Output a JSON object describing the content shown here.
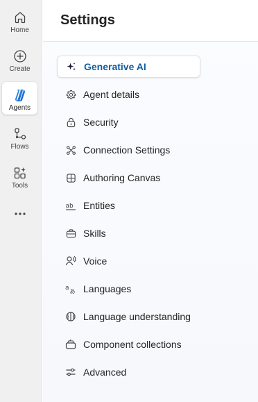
{
  "rail": {
    "items": [
      {
        "label": "Home",
        "icon": "home-icon"
      },
      {
        "label": "Create",
        "icon": "add-circle-icon"
      },
      {
        "label": "Agents",
        "icon": "agents-logo-icon",
        "active": true
      },
      {
        "label": "Flows",
        "icon": "flows-icon"
      },
      {
        "label": "Tools",
        "icon": "tools-grid-sparkle-icon"
      }
    ],
    "more_icon": "more-horizontal-icon"
  },
  "page": {
    "title": "Settings"
  },
  "nav": {
    "items": [
      {
        "label": "Generative AI",
        "icon": "sparkle-icon",
        "selected": true
      },
      {
        "label": "Agent details",
        "icon": "gear-icon"
      },
      {
        "label": "Security",
        "icon": "lock-icon"
      },
      {
        "label": "Connection Settings",
        "icon": "connection-nodes-icon"
      },
      {
        "label": "Authoring Canvas",
        "icon": "grid-icon"
      },
      {
        "label": "Entities",
        "icon": "entities-ab-icon"
      },
      {
        "label": "Skills",
        "icon": "briefcase-icon"
      },
      {
        "label": "Voice",
        "icon": "voice-person-icon"
      },
      {
        "label": "Languages",
        "icon": "translate-icon"
      },
      {
        "label": "Language understanding",
        "icon": "brain-icon"
      },
      {
        "label": "Component collections",
        "icon": "collection-box-icon"
      },
      {
        "label": "Advanced",
        "icon": "sliders-icon"
      }
    ]
  },
  "colors": {
    "accent": "#115ea3",
    "rail_bg": "#f0f0f0",
    "text": "#242424"
  }
}
